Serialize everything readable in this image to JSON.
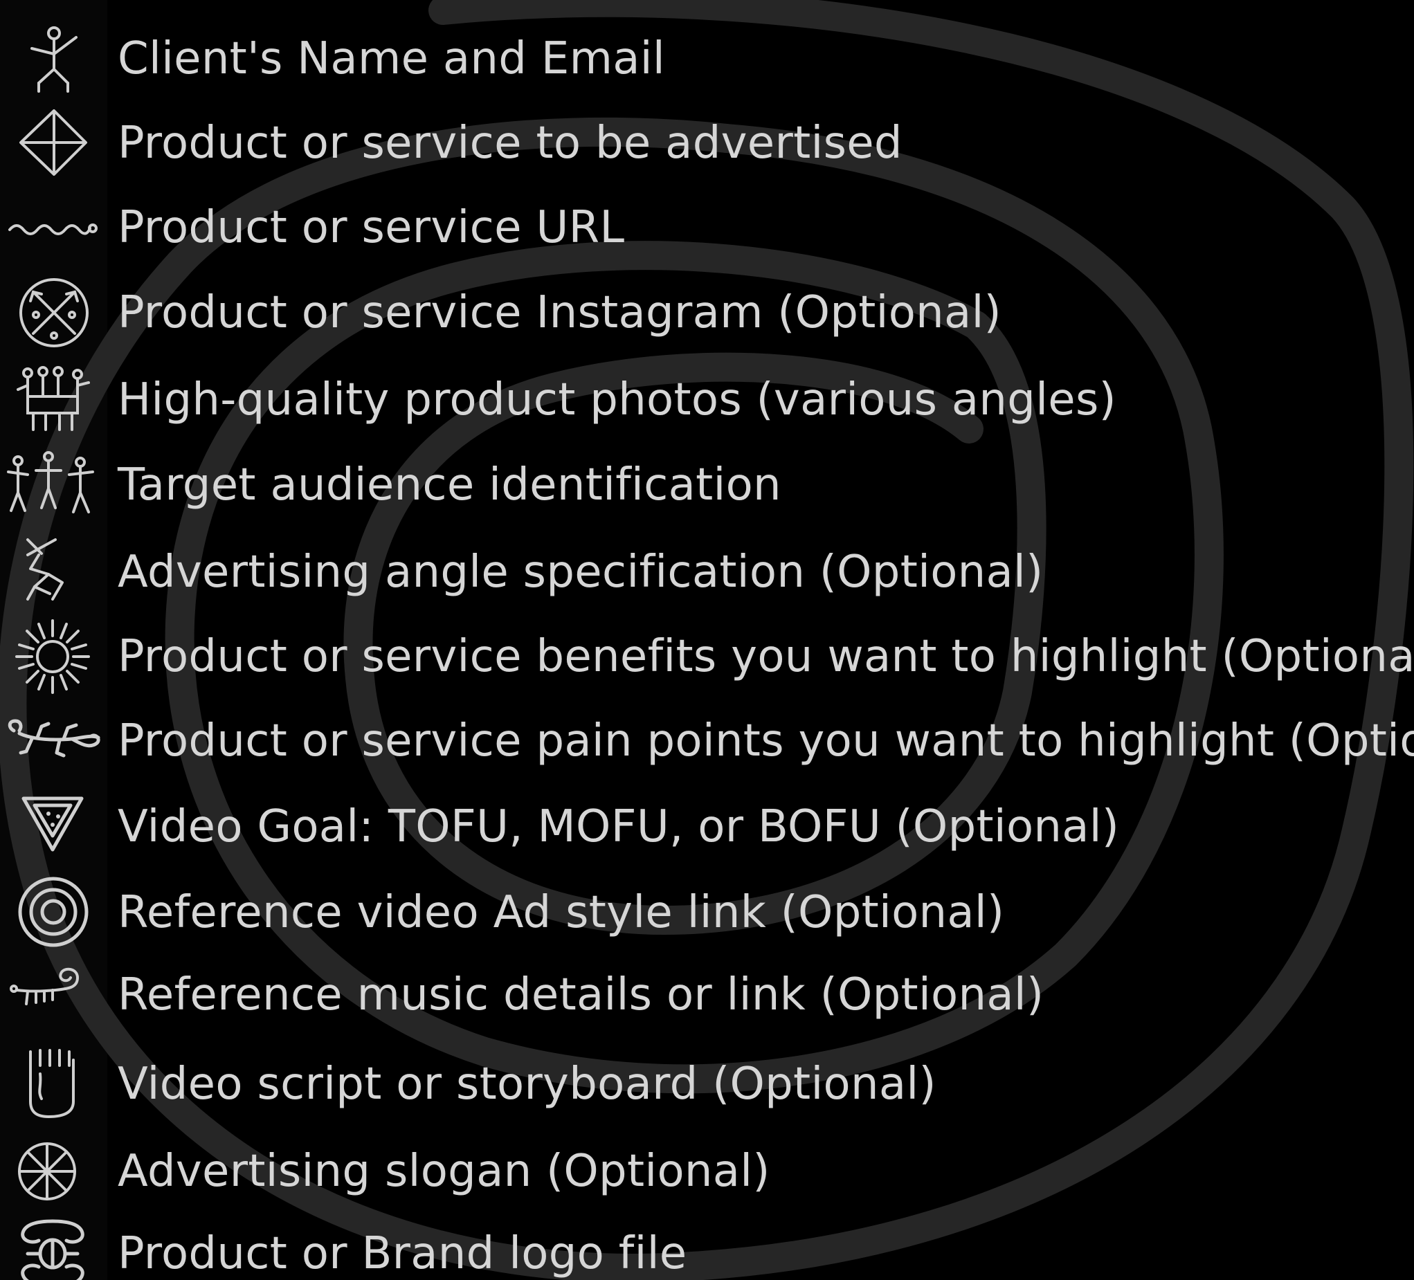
{
  "items": [
    {
      "label": "Client's Name and Email",
      "icon": "stick-figure-icon"
    },
    {
      "label": "Product or service to be advertised",
      "icon": "diamond-icon"
    },
    {
      "label": "Product or service URL",
      "icon": "wave-line-icon"
    },
    {
      "label": "Product or service Instagram (Optional)",
      "icon": "crossed-arrows-circle-icon"
    },
    {
      "label": "High-quality product photos (various angles)",
      "icon": "group-figures-icon"
    },
    {
      "label": "Target audience identification",
      "icon": "dancing-figures-icon"
    },
    {
      "label": "Advertising angle specification (Optional)",
      "icon": "zigzag-figure-icon"
    },
    {
      "label": "Product or service benefits you want to highlight (Optional)",
      "icon": "sun-icon"
    },
    {
      "label": "Product or service pain points you want to highlight (Optional)",
      "icon": "lizard-icon"
    },
    {
      "label": "Video Goal: TOFU, MOFU, or BOFU (Optional)",
      "icon": "triangle-icon"
    },
    {
      "label": "Reference video Ad style link (Optional)",
      "icon": "concentric-circles-icon"
    },
    {
      "label": "Reference music details or link (Optional)",
      "icon": "scorpion-icon"
    },
    {
      "label": "Video script or storyboard (Optional)",
      "icon": "footprint-icon"
    },
    {
      "label": "Advertising slogan (Optional)",
      "icon": "wheel-icon"
    },
    {
      "label": "Product or Brand logo file",
      "icon": "symmetric-glyph-icon"
    }
  ],
  "colors": {
    "background": "#000000",
    "text": "#d6d6d6",
    "icon": "#cfcfcf",
    "spiral": "#2a2a2a"
  }
}
